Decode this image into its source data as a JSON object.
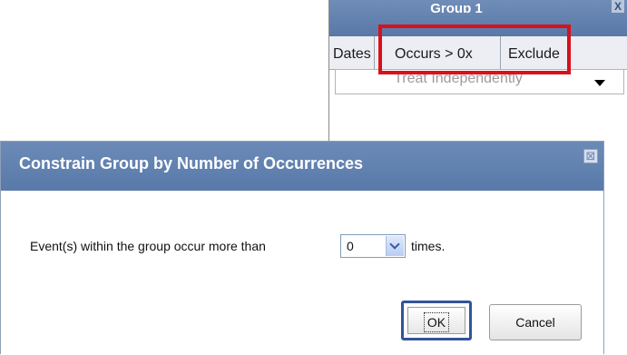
{
  "group_panel": {
    "title": "Group 1",
    "close_glyph": "X",
    "tabs": [
      {
        "label": "Dates"
      },
      {
        "label": "Occurs > 0x"
      },
      {
        "label": "Exclude"
      }
    ],
    "treat_select": {
      "value": "Treat Independently"
    }
  },
  "dialog": {
    "title": "Constrain Group by Number of Occurrences",
    "close_glyph": "⊠",
    "sentence_prefix": "Event(s) within the group occur more than",
    "occurrences_value": "0",
    "sentence_suffix": "times.",
    "ok_label": "OK",
    "cancel_label": "Cancel"
  },
  "colors": {
    "titlebar": "#587aa9",
    "highlight": "#d8111b",
    "ok_focus_border": "#34539a"
  }
}
